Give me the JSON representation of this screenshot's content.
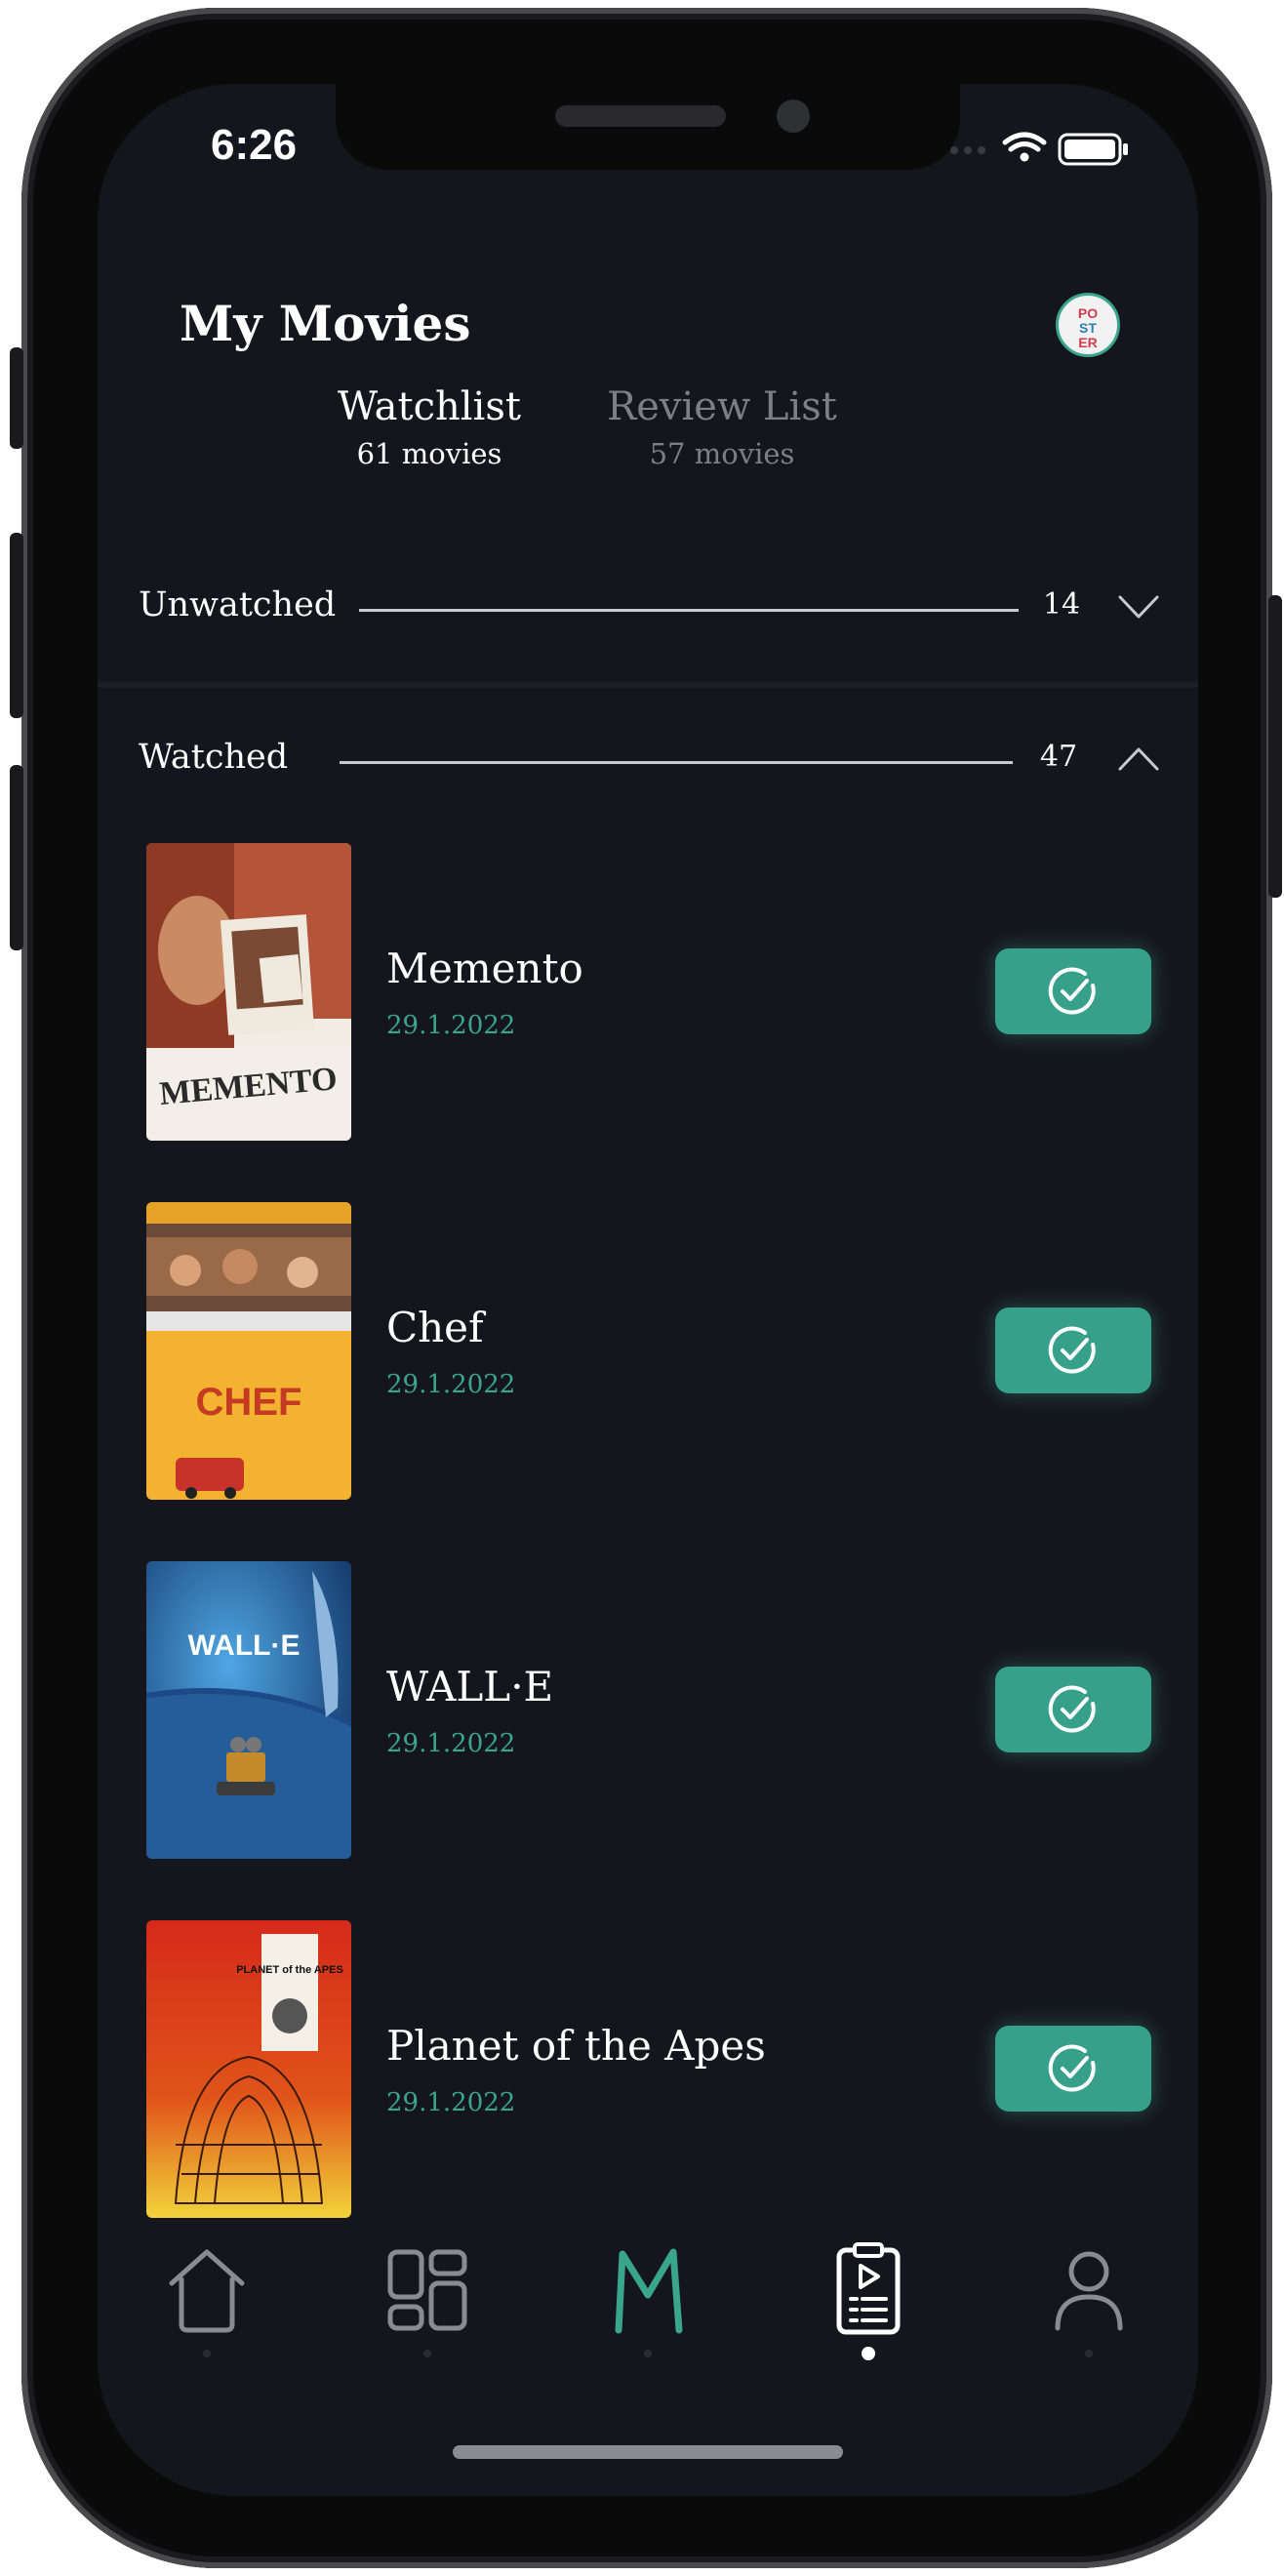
{
  "status_bar": {
    "time": "6:26"
  },
  "header": {
    "title": "My Movies",
    "logo_text": [
      "PO",
      "ST",
      "ER"
    ]
  },
  "tabs": [
    {
      "label": "Watchlist",
      "count": "61 movies",
      "active": true
    },
    {
      "label": "Review List",
      "count": "57 movies",
      "active": false
    }
  ],
  "sections": {
    "unwatched": {
      "label": "Unwatched",
      "count": "14",
      "expanded": false
    },
    "watched": {
      "label": "Watched",
      "count": "47",
      "expanded": true
    }
  },
  "movies": [
    {
      "title": "Memento",
      "date": "29.1.2022",
      "poster_text": "MEMENTO"
    },
    {
      "title": "Chef",
      "date": "29.1.2022",
      "poster_text": "CHEF"
    },
    {
      "title": "WALL·E",
      "date": "29.1.2022",
      "poster_text": "WALL·E"
    },
    {
      "title": "Planet of the Apes",
      "date": "29.1.2022",
      "poster_text": "PLANET of the APES"
    }
  ],
  "nav": {
    "items": [
      "home-icon",
      "dashboard-icon",
      "m-logo-icon",
      "watchlist-icon",
      "profile-icon"
    ],
    "active_index": 3
  },
  "colors": {
    "accent": "#37a08a",
    "background": "#15161d",
    "muted": "#7d7e86"
  }
}
